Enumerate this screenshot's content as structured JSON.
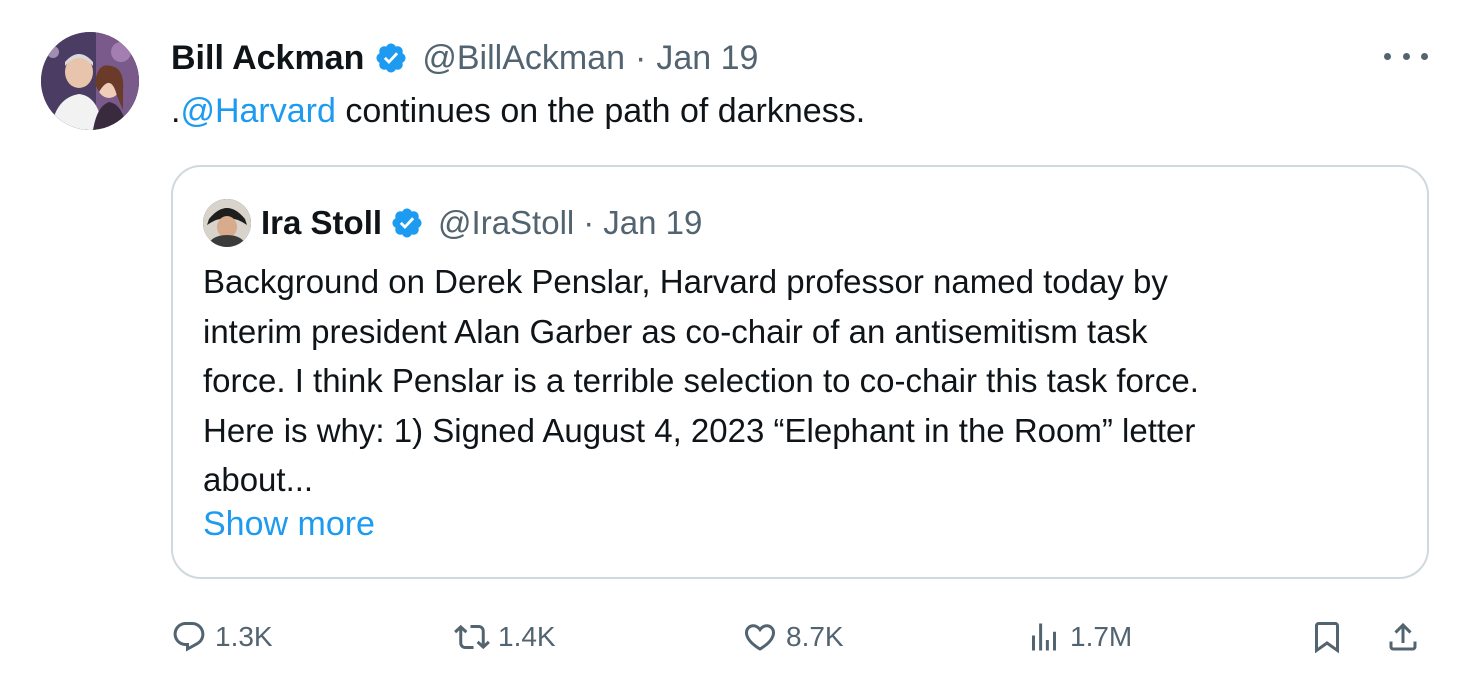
{
  "tweet": {
    "author_name": "Bill Ackman",
    "handle": "@BillAckman",
    "separator": "·",
    "date": "Jan 19",
    "text_prefix": ".",
    "text_mention": "@Harvard",
    "text_rest": " continues on the path of darkness."
  },
  "quoted": {
    "author_name": "Ira Stoll",
    "handle": "@IraStoll",
    "separator": "·",
    "date": "Jan 19",
    "lines": [
      "Background on Derek Penslar, Harvard professor named today by",
      "interim president Alan Garber as co-chair of an antisemitism task",
      "force. I think Penslar is a terrible selection to co-chair this task force.",
      "Here is why: 1) Signed August 4, 2023 “Elephant in the Room” letter",
      "about..."
    ],
    "show_more": "Show more"
  },
  "actions": {
    "replies": "1.3K",
    "reposts": "1.4K",
    "likes": "8.7K",
    "views": "1.7M"
  },
  "icons": {
    "verified": "verified-badge-icon",
    "more": "more-icon",
    "reply": "reply-icon",
    "repost": "repost-icon",
    "like": "heart-icon",
    "views": "views-icon",
    "bookmark": "bookmark-icon",
    "share": "share-icon"
  },
  "colors": {
    "accent": "#1d9bf0",
    "text": "#0f1419",
    "secondary": "#536471",
    "border": "#cfd9de"
  }
}
